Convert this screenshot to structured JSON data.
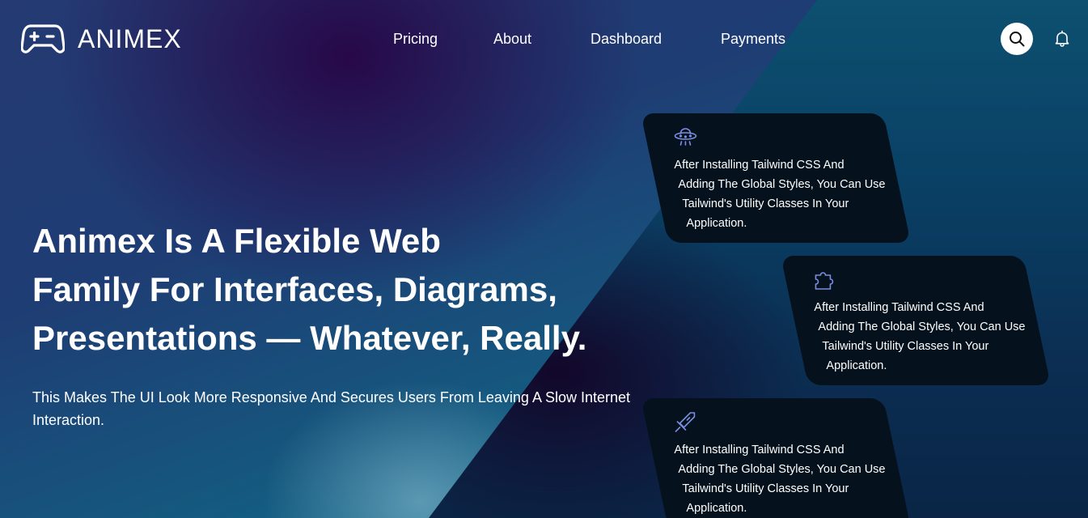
{
  "brand": {
    "name": "ANIMEX",
    "logo_icon": "gamepad-icon"
  },
  "nav": {
    "items": [
      "Pricing",
      "About",
      "Dashboard",
      "Payments"
    ]
  },
  "header_actions": {
    "search_icon": "search-icon",
    "bell_icon": "bell-icon"
  },
  "hero": {
    "title": "Animex Is A Flexible Web\nFamily For Interfaces, Diagrams,\nPresentations — Whatever, Really.",
    "subtitle": "This Makes The UI Look More Responsive And Secures Users From Leaving A Slow Internet Interaction."
  },
  "cards": [
    {
      "icon": "ufo-icon",
      "lines": [
        "After Installing Tailwind CSS And",
        "Adding The Global Styles, You Can Use",
        "Tailwind's Utility Classes In Your",
        "Application."
      ]
    },
    {
      "icon": "puzzle-icon",
      "lines": [
        "After Installing Tailwind CSS And",
        "Adding The Global Styles, You Can Use",
        "Tailwind's Utility Classes In Your",
        "Application."
      ]
    },
    {
      "icon": "sword-icon",
      "lines": [
        "After Installing Tailwind CSS And",
        "Adding The Global Styles, You Can Use",
        "Tailwind's Utility Classes In Your",
        "Application."
      ]
    }
  ],
  "colors": {
    "accent_icon": "#7b8de0",
    "card_bg": "#05121e"
  }
}
